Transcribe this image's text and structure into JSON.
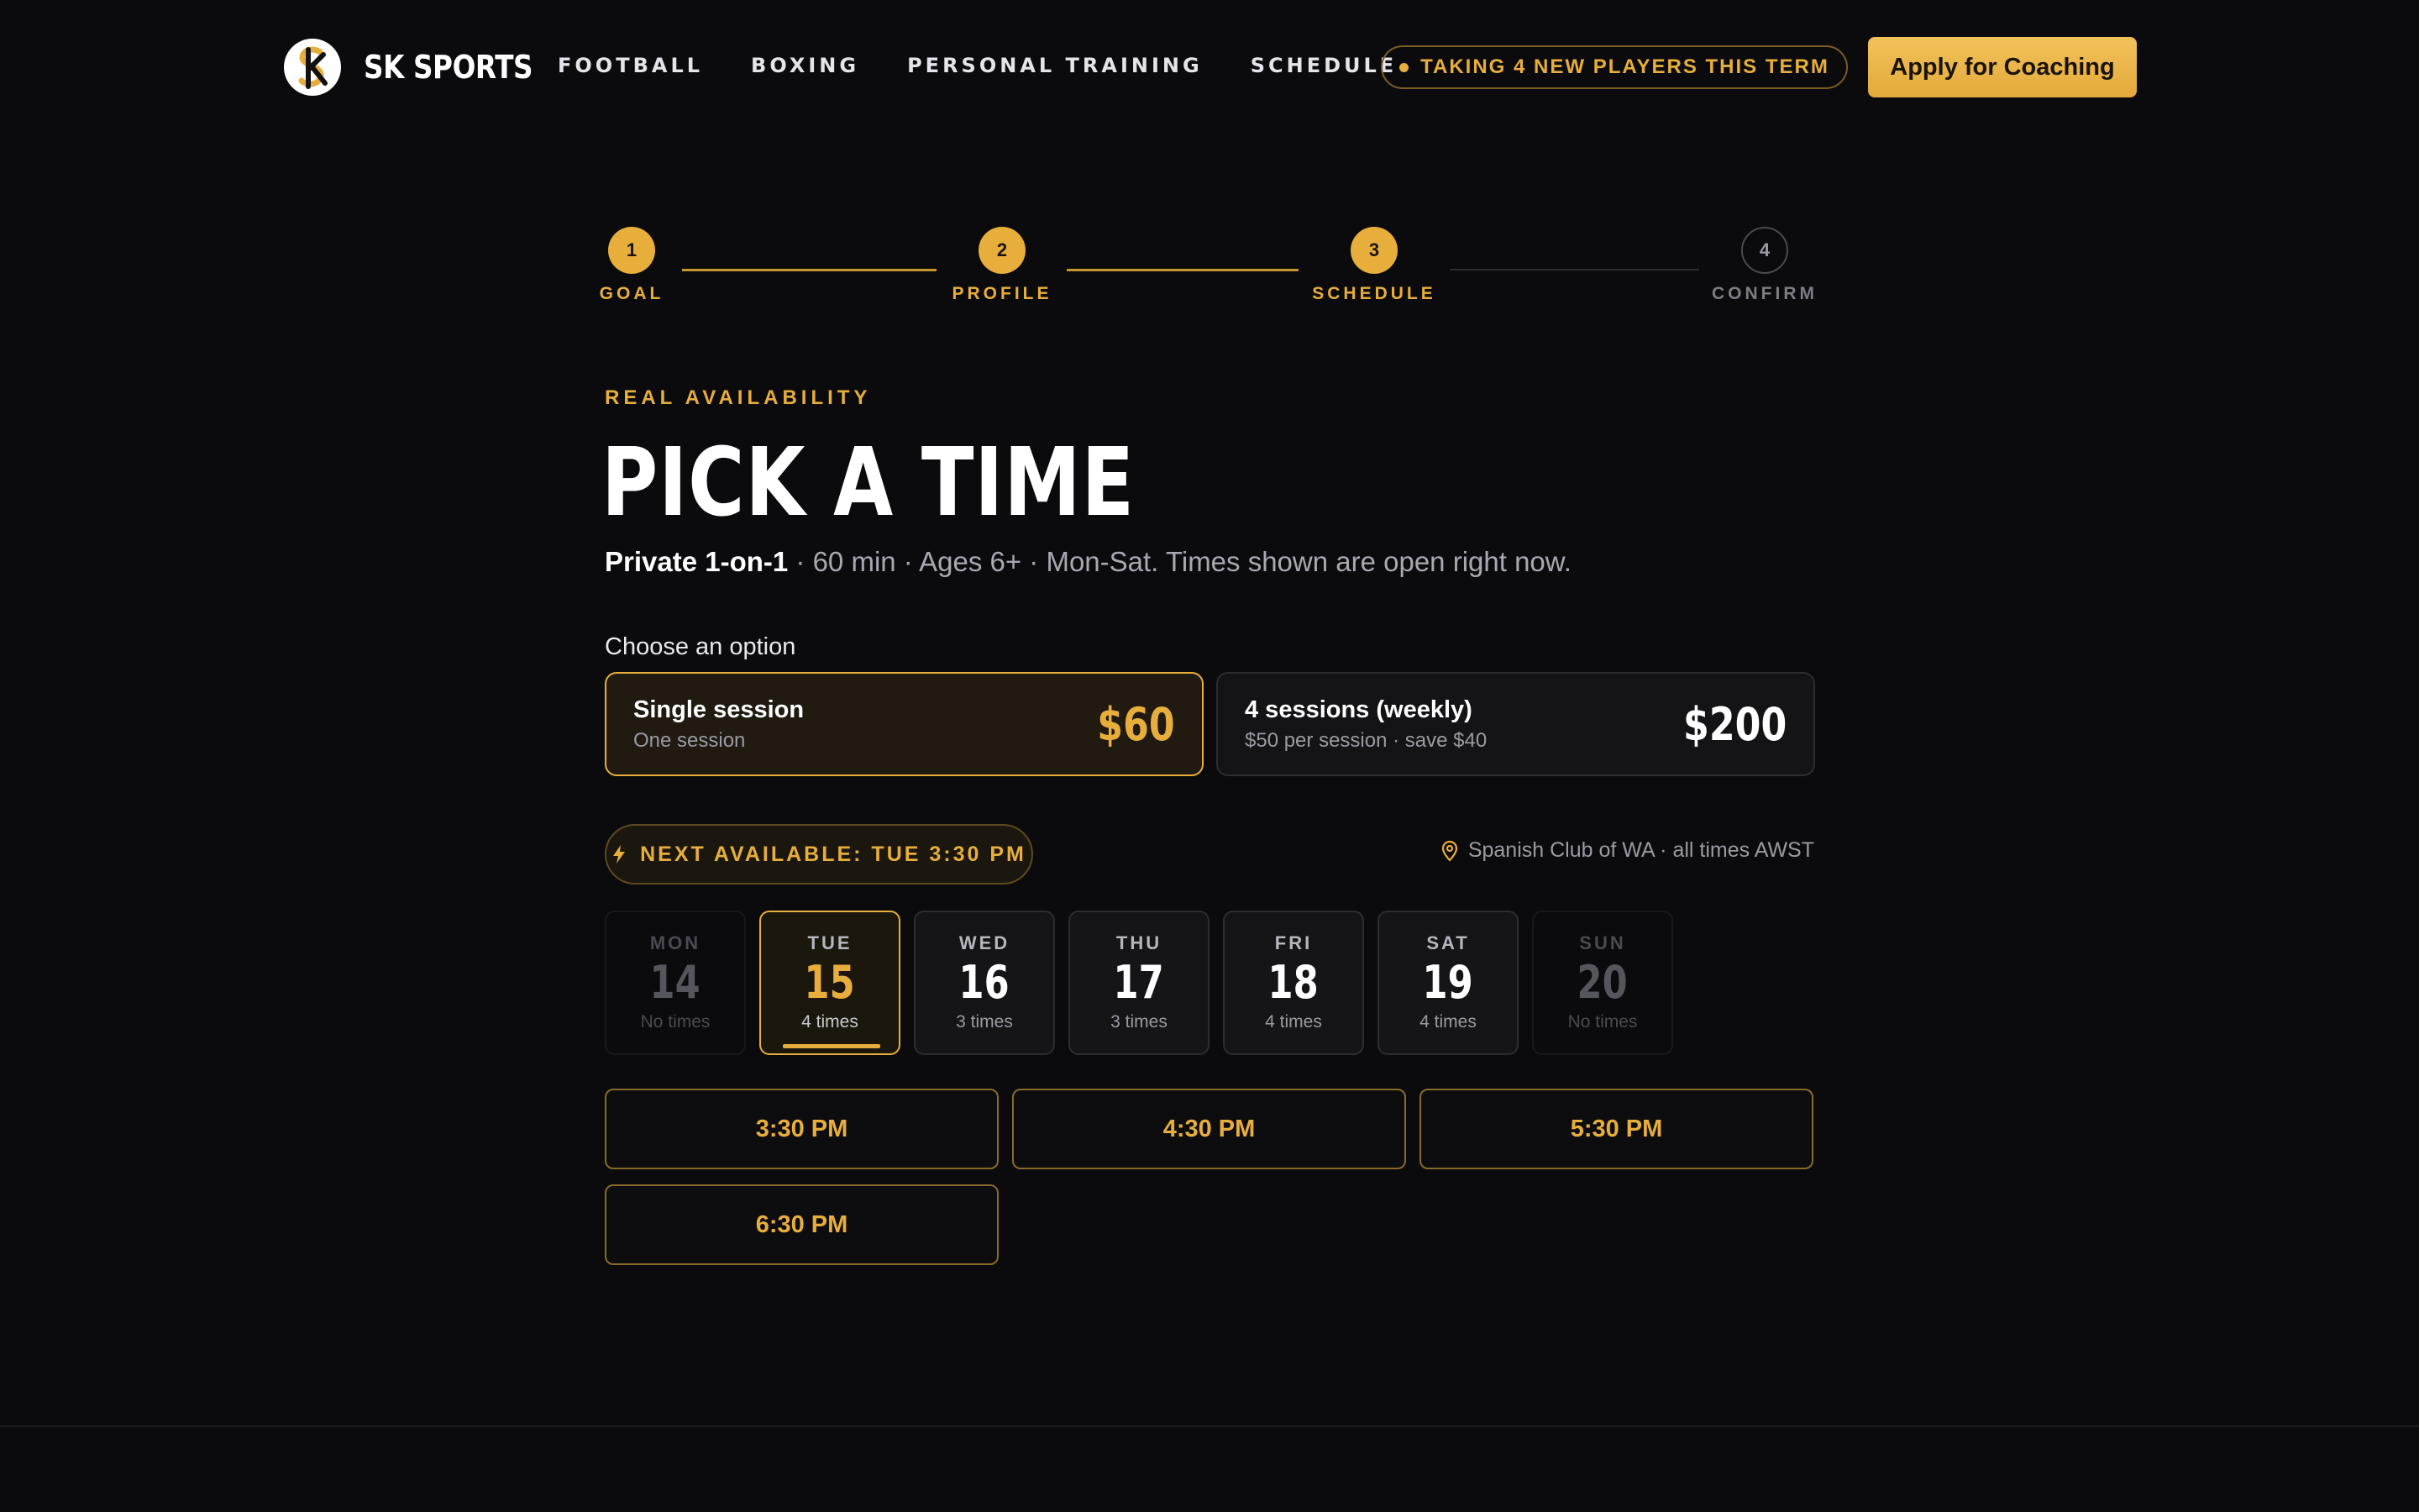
{
  "nav": {
    "brand": "SK SPORTS",
    "links": [
      "FOOTBALL",
      "BOXING",
      "PERSONAL TRAINING",
      "SCHEDULE"
    ],
    "banner": "TAKING 4 NEW PLAYERS THIS TERM",
    "cta": "Apply for Coaching"
  },
  "stepper": {
    "steps": [
      {
        "num": "1",
        "label": "GOAL",
        "state": "done"
      },
      {
        "num": "2",
        "label": "PROFILE",
        "state": "done"
      },
      {
        "num": "3",
        "label": "SCHEDULE",
        "state": "current"
      },
      {
        "num": "4",
        "label": "CONFIRM",
        "state": "upcoming"
      }
    ]
  },
  "page": {
    "eyebrow": "REAL AVAILABILITY",
    "title": "PICK A TIME",
    "subtitle_strong": "Private 1-on-1",
    "subtitle_rest": " · 60 min · Ages 6+ · Mon-Sat. Times shown are open right now.",
    "choose_label": "Choose an option"
  },
  "options": [
    {
      "title": "Single session",
      "sub": "One session",
      "price": "$60",
      "selected": true
    },
    {
      "title": "4 sessions (weekly)",
      "sub": "$50 per session · save $40",
      "price": "$200",
      "selected": false
    }
  ],
  "availability": {
    "next": "NEXT AVAILABLE: TUE 3:30 PM",
    "location": "Spanish Club of WA · all times AWST"
  },
  "days": [
    {
      "name": "MON",
      "num": "14",
      "times": "No times"
    },
    {
      "name": "TUE",
      "num": "15",
      "times": "4 times"
    },
    {
      "name": "WED",
      "num": "16",
      "times": "3 times"
    },
    {
      "name": "THU",
      "num": "17",
      "times": "3 times"
    },
    {
      "name": "FRI",
      "num": "18",
      "times": "4 times"
    },
    {
      "name": "SAT",
      "num": "19",
      "times": "4 times"
    },
    {
      "name": "SUN",
      "num": "20",
      "times": "No times"
    }
  ],
  "slots": [
    "3:30 PM",
    "4:30 PM",
    "5:30 PM",
    "6:30 PM"
  ],
  "colors": {
    "accent": "#e8ae3c",
    "background": "#0b0b0d"
  }
}
